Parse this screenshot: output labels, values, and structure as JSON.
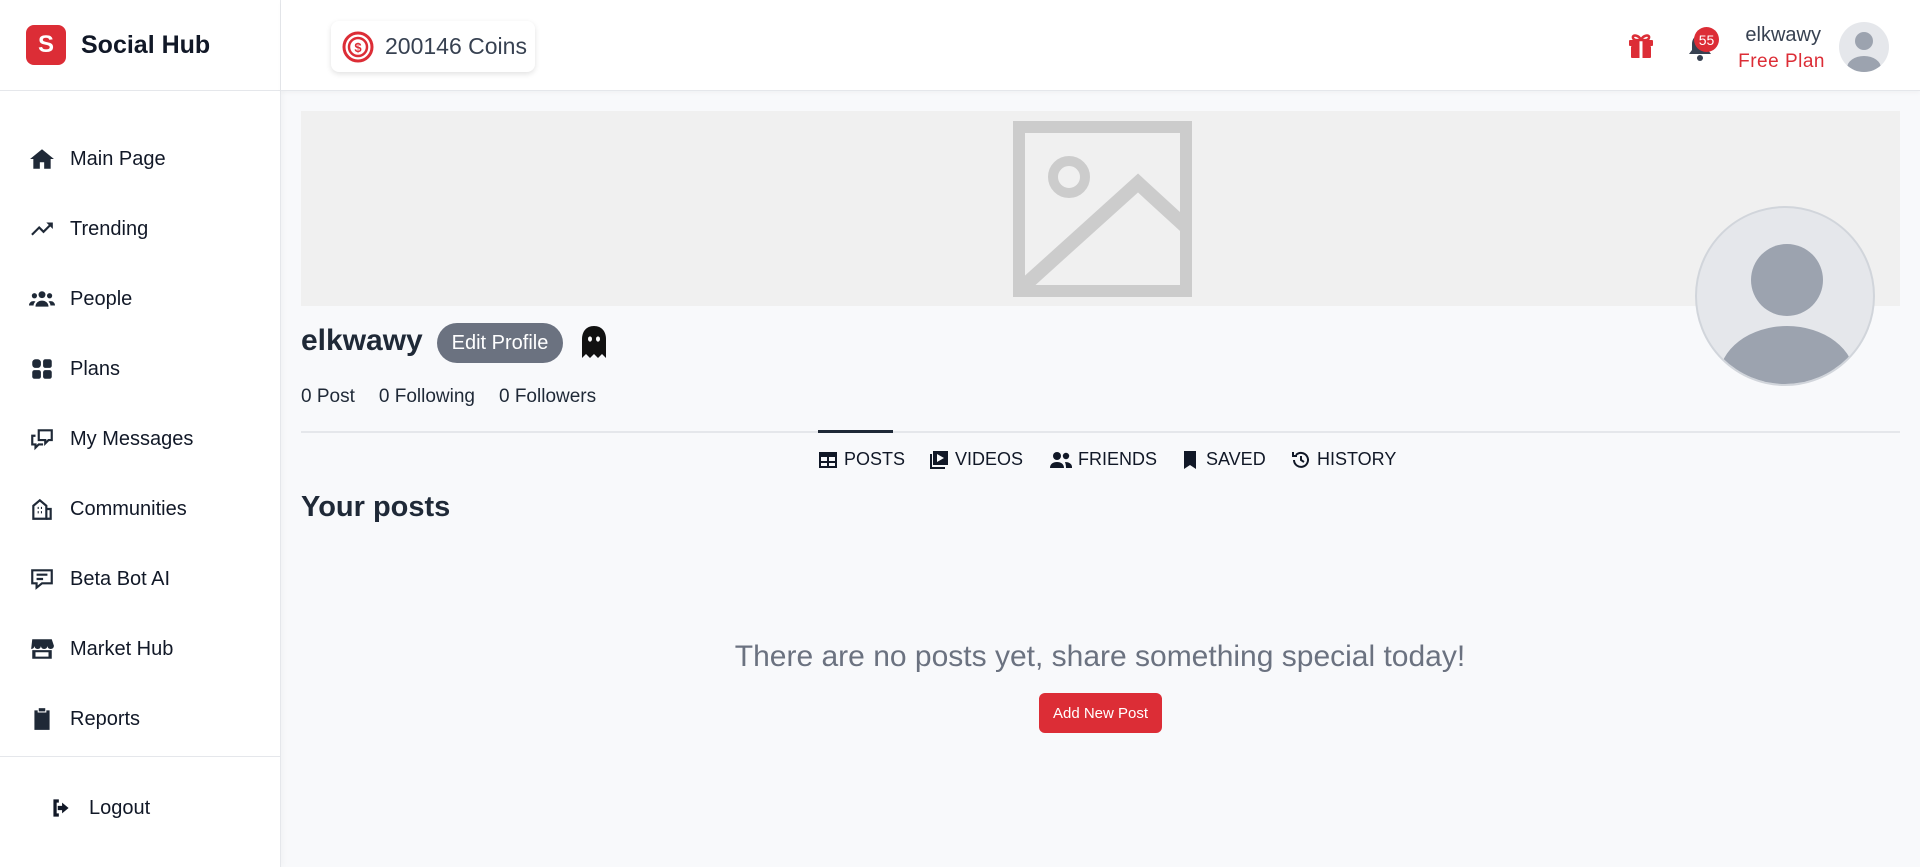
{
  "brand": {
    "logo_letter": "S",
    "name": "Social Hub"
  },
  "sidebar": {
    "items": [
      {
        "label": "Main Page",
        "icon": "home-icon"
      },
      {
        "label": "Trending",
        "icon": "trending-icon"
      },
      {
        "label": "People",
        "icon": "people-icon"
      },
      {
        "label": "Plans",
        "icon": "plans-icon"
      },
      {
        "label": "My Messages",
        "icon": "messages-icon"
      },
      {
        "label": "Communities",
        "icon": "communities-icon"
      },
      {
        "label": "Beta Bot AI",
        "icon": "bot-icon"
      },
      {
        "label": "Market Hub",
        "icon": "store-icon"
      },
      {
        "label": "Reports",
        "icon": "clipboard-icon"
      }
    ],
    "logout_label": "Logout"
  },
  "header": {
    "coins_label": "200146 Coins",
    "notification_count": "55",
    "user_name": "elkwawy",
    "user_plan": "Free Plan"
  },
  "profile": {
    "name": "elkwawy",
    "edit_label": "Edit Profile",
    "stats": {
      "posts": "0 Post",
      "following": "0 Following",
      "followers": "0 Followers"
    }
  },
  "tabs": [
    {
      "label": "POSTS",
      "icon": "table-icon",
      "active": true
    },
    {
      "label": "VIDEOS",
      "icon": "video-icon",
      "active": false
    },
    {
      "label": "FRIENDS",
      "icon": "friends-icon",
      "active": false
    },
    {
      "label": "SAVED",
      "icon": "bookmark-icon",
      "active": false
    },
    {
      "label": "HISTORY",
      "icon": "history-icon",
      "active": false
    }
  ],
  "posts": {
    "section_title": "Your posts",
    "empty_message": "There are no posts yet, share something special today!",
    "add_label": "Add New Post"
  },
  "colors": {
    "accent": "#dc2d36",
    "text": "#1f2937",
    "muted": "#6b7280",
    "cover_bg": "#f0f0f0"
  }
}
